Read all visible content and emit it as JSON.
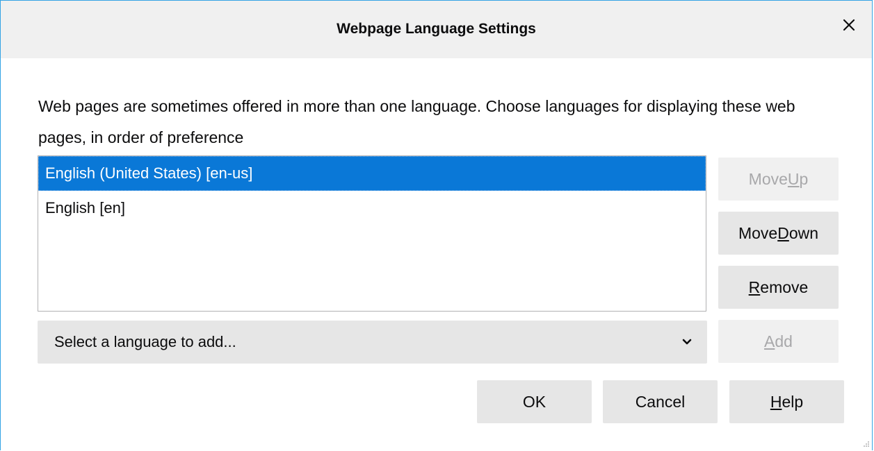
{
  "dialog": {
    "title": "Webpage Language Settings",
    "description": "Web pages are sometimes offered in more than one language. Choose languages for displaying these web pages, in order of preference"
  },
  "languages": [
    {
      "label": "English (United States) [en-us]",
      "selected": true
    },
    {
      "label": "English [en]",
      "selected": false
    }
  ],
  "buttons": {
    "move_up": {
      "pre": "Move ",
      "key": "U",
      "post": "p",
      "disabled": true
    },
    "move_down": {
      "pre": "Move ",
      "key": "D",
      "post": "own",
      "disabled": false
    },
    "remove": {
      "pre": "",
      "key": "R",
      "post": "emove",
      "disabled": false
    },
    "add": {
      "pre": "",
      "key": "A",
      "post": "dd",
      "disabled": true
    },
    "ok": {
      "label": "OK"
    },
    "cancel": {
      "label": "Cancel"
    },
    "help": {
      "pre": "",
      "key": "H",
      "post": "elp"
    }
  },
  "select": {
    "label": "Select a language to add..."
  },
  "colors": {
    "accent": "#0a78d7",
    "border": "#33a3e5"
  },
  "icons": {
    "close": "close-icon",
    "dropdown": "chevron-down-icon",
    "resize": "resize-grip-icon"
  }
}
